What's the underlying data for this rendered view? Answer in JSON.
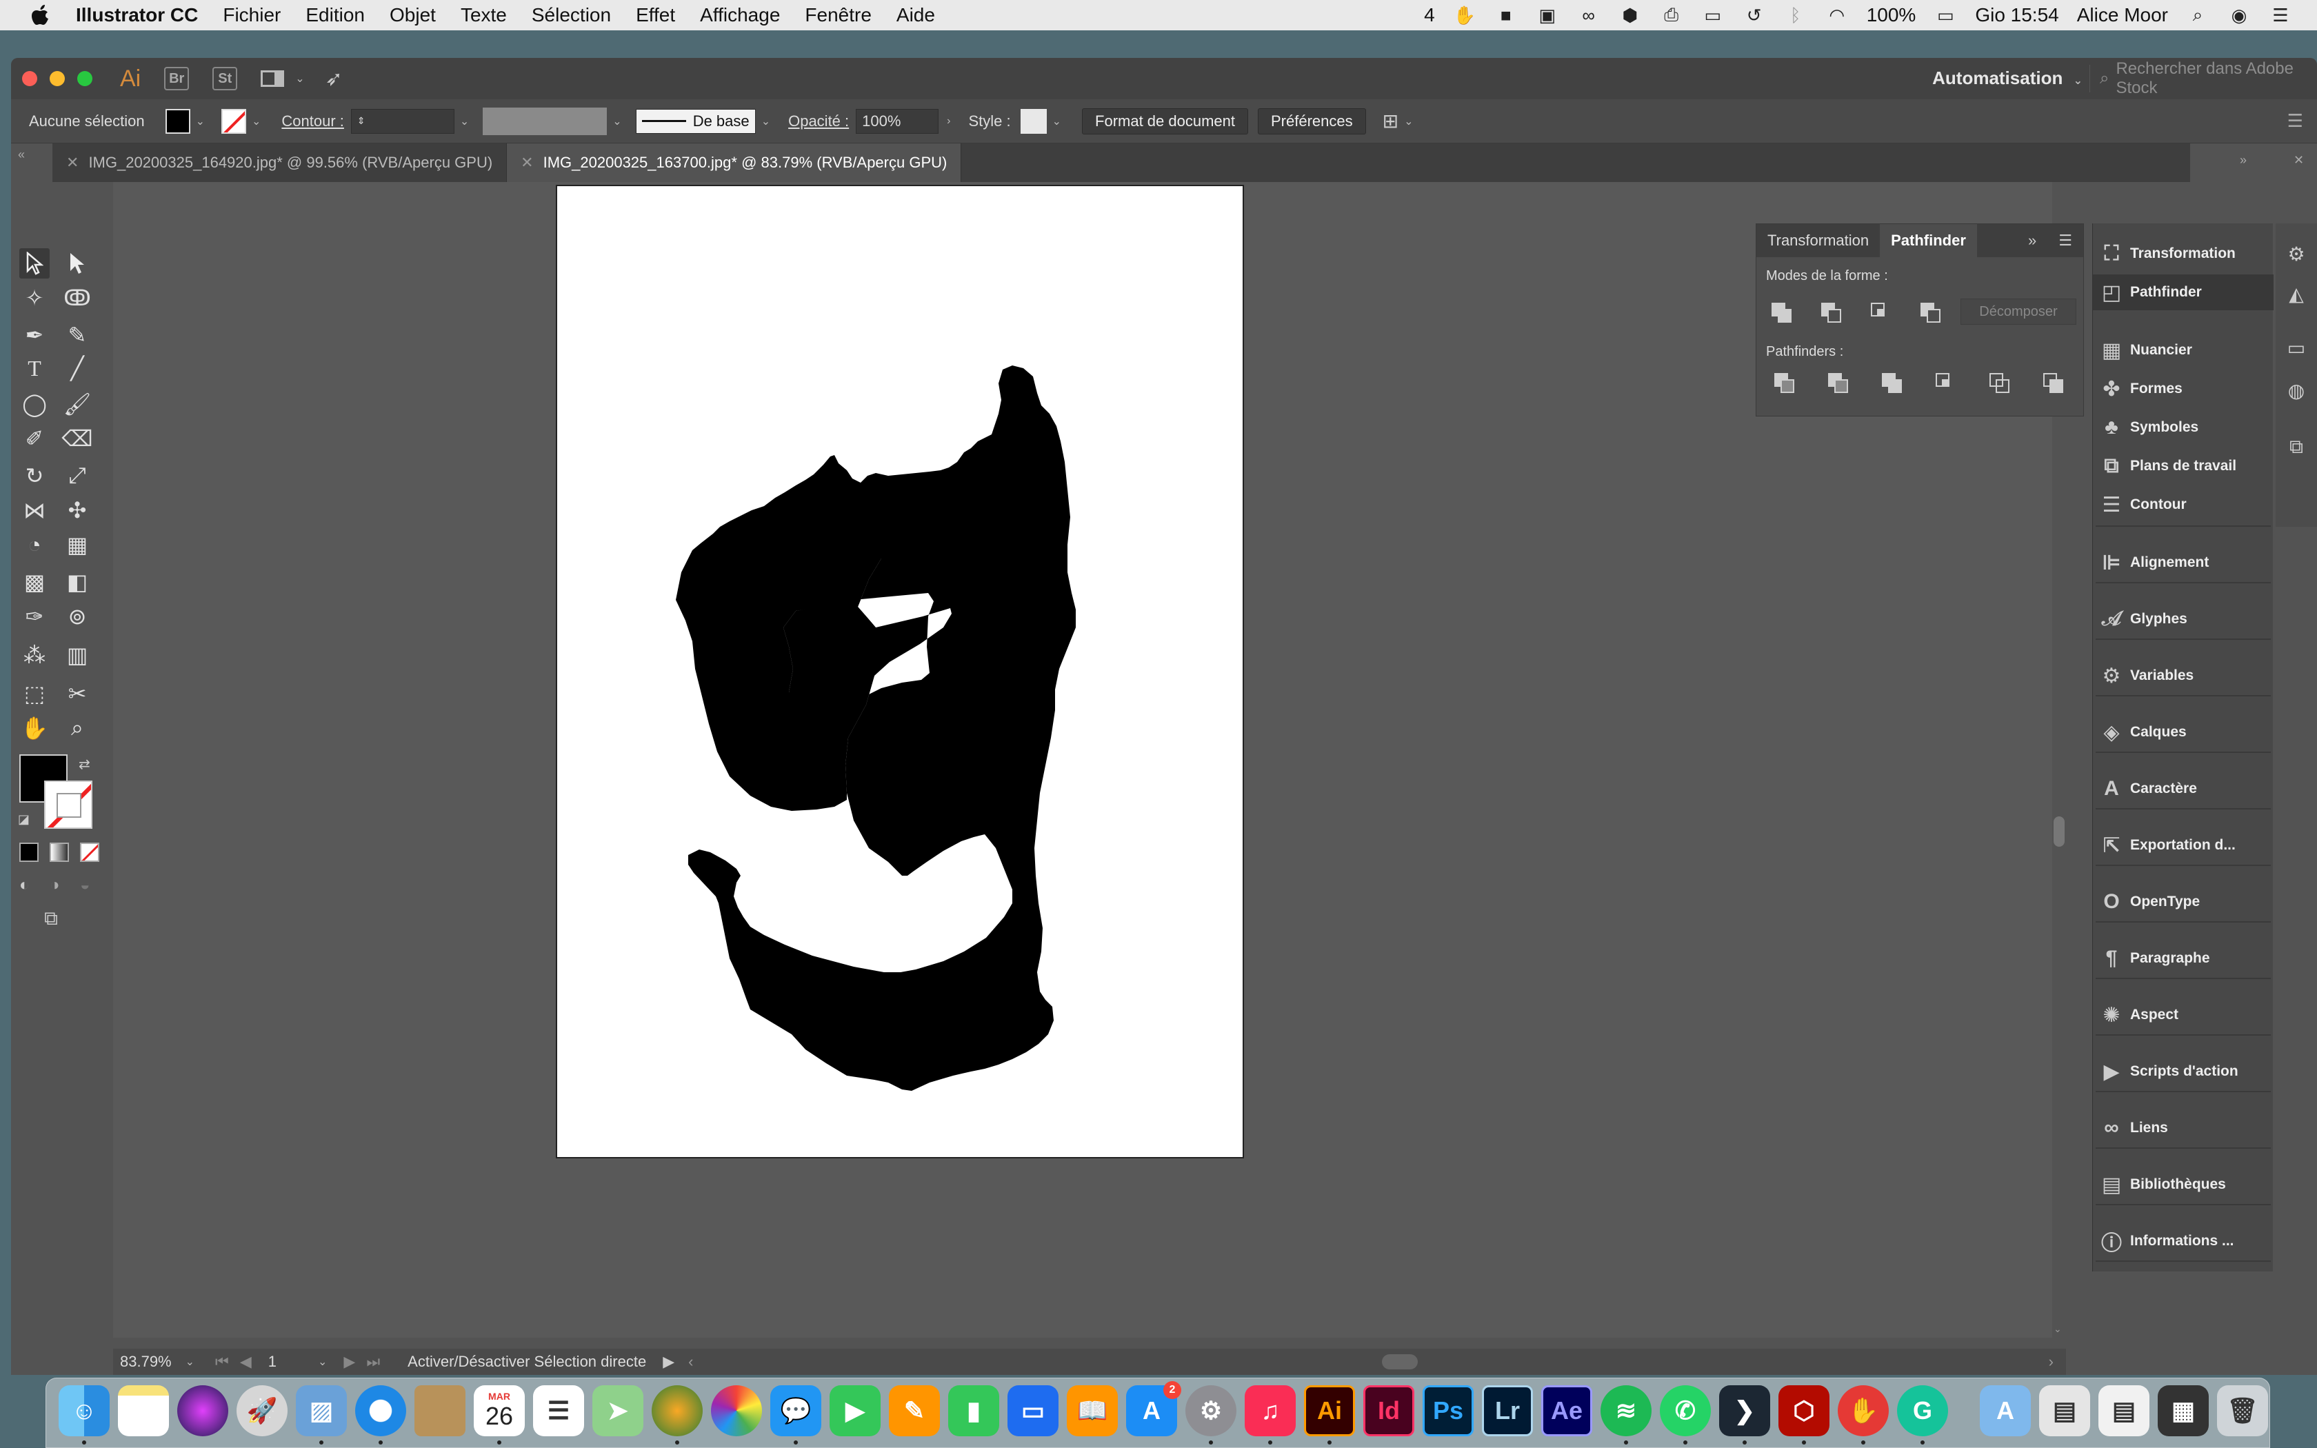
{
  "menubar": {
    "app_name": "Illustrator CC",
    "menus": [
      "Fichier",
      "Edition",
      "Objet",
      "Texte",
      "Sélection",
      "Effet",
      "Affichage",
      "Fenêtre",
      "Aide"
    ],
    "status_num": "4",
    "battery": "100%",
    "clock": "Gio 15:54",
    "user": "Alice Moor"
  },
  "titlebar": {
    "brand": "Ai",
    "br_label": "Br",
    "st_label": "St",
    "workspace": "Automatisation",
    "search_placeholder": "Rechercher dans Adobe Stock"
  },
  "controlbar": {
    "selection": "Aucune sélection",
    "contour_label": "Contour :",
    "stroke_profile": "De base",
    "opacity_label": "Opacité :",
    "opacity_value": "100%",
    "style_label": "Style :",
    "doc_format_button": "Format de document",
    "prefs_button": "Préférences"
  },
  "tabs": [
    {
      "label": "IMG_20200325_164920.jpg* @ 99.56% (RVB/Aperçu GPU)",
      "active": false
    },
    {
      "label": "IMG_20200325_163700.jpg* @ 83.79% (RVB/Aperçu GPU)",
      "active": true
    }
  ],
  "status": {
    "zoom": "83.79%",
    "page": "1",
    "message": "Activer/Désactiver Sélection directe"
  },
  "pathfinder_panel": {
    "tab_transform": "Transformation",
    "tab_pathfinder": "Pathfinder",
    "shape_modes_label": "Modes de la forme :",
    "expand_button": "Décomposer",
    "pathfinders_label": "Pathfinders :"
  },
  "dock_panels": [
    {
      "label": "Transformation",
      "icon": "transform-icon"
    },
    {
      "label": "Pathfinder",
      "icon": "pathfinder-icon"
    },
    {
      "label": "Nuancier",
      "icon": "swatches-icon"
    },
    {
      "label": "Formes",
      "icon": "brushes-icon"
    },
    {
      "label": "Symboles",
      "icon": "symbols-icon"
    },
    {
      "label": "Plans de travail",
      "icon": "artboards-icon"
    },
    {
      "label": "Contour",
      "icon": "stroke-icon"
    },
    {
      "label": "Alignement",
      "icon": "align-icon"
    },
    {
      "label": "Glyphes",
      "icon": "glyphs-icon"
    },
    {
      "label": "Variables",
      "icon": "variables-icon"
    },
    {
      "label": "Calques",
      "icon": "layers-icon"
    },
    {
      "label": "Caractère",
      "icon": "character-icon"
    },
    {
      "label": "Exportation d...",
      "icon": "export-icon"
    },
    {
      "label": "OpenType",
      "icon": "opentype-icon"
    },
    {
      "label": "Paragraphe",
      "icon": "paragraph-icon"
    },
    {
      "label": "Aspect",
      "icon": "appearance-icon"
    },
    {
      "label": "Scripts d'action",
      "icon": "actions-icon"
    },
    {
      "label": "Liens",
      "icon": "links-icon"
    },
    {
      "label": "Bibliothèques",
      "icon": "libraries-icon"
    },
    {
      "label": "Informations ...",
      "icon": "info-icon"
    }
  ],
  "macos_dock": {
    "calendar_month": "MAR",
    "calendar_day": "26",
    "appstore_badge": "2",
    "app_labels": [
      "Ai",
      "Id",
      "Ps",
      "Lr",
      "Ae"
    ]
  },
  "colors": {
    "ai_orange": "#ff9a00",
    "id_pink": "#ff3366",
    "ps_blue": "#31a8ff",
    "lr_blue": "#add5ec",
    "ae_purple": "#9999ff"
  }
}
